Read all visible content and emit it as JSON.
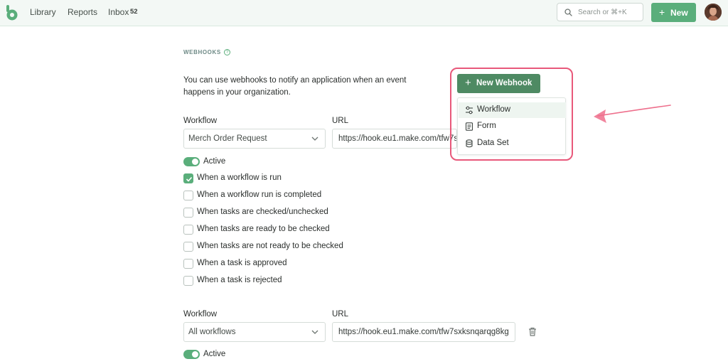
{
  "nav": {
    "library": "Library",
    "reports": "Reports",
    "inbox": "Inbox",
    "inbox_count": "52",
    "search_placeholder": "Search or ⌘+K",
    "new_button": "New"
  },
  "webhooks": {
    "section_title": "WEBHOOKS",
    "intro": "You can use webhooks to notify an application when an event happens in your organization.",
    "new_webhook_button": "New Webhook",
    "dropdown": [
      {
        "label": "Workflow",
        "icon": "workflow-icon"
      },
      {
        "label": "Form",
        "icon": "form-icon"
      },
      {
        "label": "Data Set",
        "icon": "database-icon"
      }
    ],
    "items": [
      {
        "workflow_label": "Workflow",
        "url_label": "URL",
        "workflow_value": "Merch Order Request",
        "url_value": "https://hook.eu1.make.com/tfw7sxksnqarqg8kg",
        "active_label": "Active",
        "triggers": [
          {
            "label": "When a workflow is run",
            "checked": true
          },
          {
            "label": "When a workflow run is completed",
            "checked": false
          },
          {
            "label": "When tasks are checked/unchecked",
            "checked": false
          },
          {
            "label": "When tasks are ready to be checked",
            "checked": false
          },
          {
            "label": "When tasks are not ready to be checked",
            "checked": false
          },
          {
            "label": "When a task is approved",
            "checked": false
          },
          {
            "label": "When a task is rejected",
            "checked": false
          }
        ]
      },
      {
        "workflow_label": "Workflow",
        "url_label": "URL",
        "workflow_value": "All workflows",
        "url_value": "https://hook.eu1.make.com/tfw7sxksnqarqg8kg",
        "active_label": "Active"
      }
    ]
  },
  "colors": {
    "brand_green": "#5aae7b",
    "dark_green": "#4e8a63",
    "highlight_pink": "#e8587a"
  }
}
